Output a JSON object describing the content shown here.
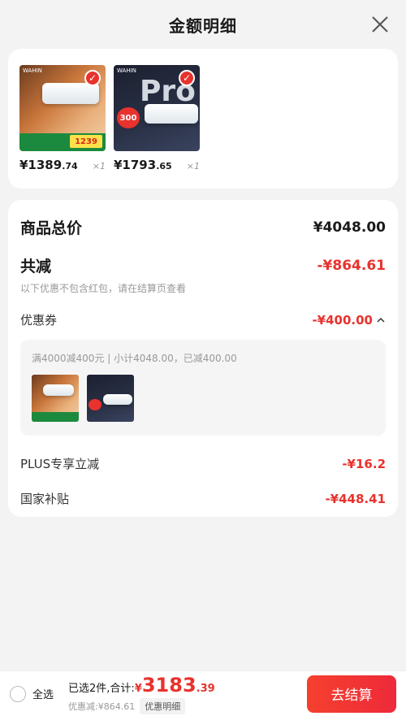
{
  "header": {
    "title": "金额明细"
  },
  "products": [
    {
      "brand": "WAHIN",
      "price_int": "¥1389",
      "price_dec": ".74",
      "qty": "×1",
      "promo": "1239"
    },
    {
      "brand": "WAHIN",
      "price_int": "¥1793",
      "price_dec": ".65",
      "qty": "×1",
      "promo": "300",
      "pro": "Pro"
    }
  ],
  "detail": {
    "total_label": "商品总价",
    "total_value": "¥4048.00",
    "discount_label": "共减",
    "discount_value": "-¥864.61",
    "discount_note": "以下优惠不包含红包，请在结算页查看",
    "coupon_label": "优惠券",
    "coupon_value": "-¥400.00",
    "coupon_note": "满4000减400元 | 小计4048.00，已减400.00",
    "plus_label": "PLUS专享立减",
    "plus_value": "-¥16.2",
    "subsidy_label": "国家补贴",
    "subsidy_value": "-¥448.41"
  },
  "bottom": {
    "select_all": "全选",
    "selected_text": "已选2件,合计:",
    "currency": "¥",
    "total_int": "3183",
    "total_dec": ".39",
    "saved": "优惠减:¥864.61",
    "detail_btn": "优惠明细",
    "checkout": "去结算"
  },
  "colors": {
    "accent": "#e8322d",
    "background": "#f3f3f3"
  }
}
